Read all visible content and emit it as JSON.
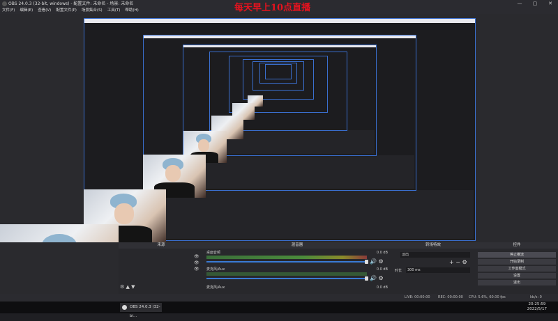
{
  "window": {
    "title": "OBS 24.0.3 (32-bit, windows) - 配置文件: 未命名 - 场景: 未命名"
  },
  "menu": [
    "文件(F)",
    "编辑(E)",
    "查看(V)",
    "配置文件(P)",
    "场景集合(S)",
    "工具(T)",
    "帮助(H)"
  ],
  "banner": {
    "text": "每天早上10点直播",
    "color": "#e8121e"
  },
  "docks": {
    "sources": {
      "header": "来源",
      "items": [
        "",
        "",
        ""
      ]
    },
    "mixer": {
      "header": "混音器",
      "channels": [
        {
          "name": "桌面音频",
          "db": "0.0 dB"
        },
        {
          "name": "麦克风/Aux",
          "db": "0.0 dB"
        },
        {
          "name": "麦克风/Aux",
          "db": "0.0 dB"
        }
      ]
    },
    "transitions": {
      "header": "转场特效",
      "type": "淡出",
      "duration_label": "时长",
      "duration_value": "300 ms"
    },
    "controls": {
      "header": "控件",
      "buttons": [
        "停止推流",
        "开始录制",
        "工作室模式",
        "设置",
        "退出"
      ]
    }
  },
  "status": {
    "live": "LIVE: 00:00:00",
    "rec": "REC: 00:00:00",
    "cpu": "CPU: 5.6%, 60.00 fps",
    "kbps": "kb/s: 0"
  },
  "taskbar": {
    "app": "OBS 24.0.3 (32-bi...",
    "time": "20:25:59",
    "date": "2022/5/17"
  },
  "colors": {
    "accent": "#3a7bd5",
    "banner_red": "#e8121e"
  }
}
